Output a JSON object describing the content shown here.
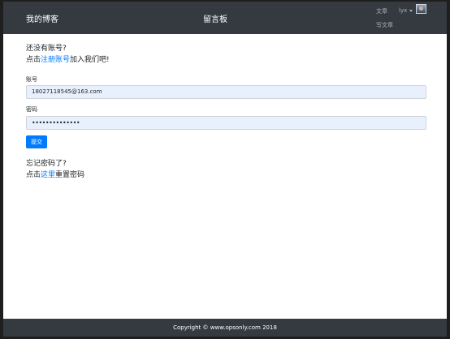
{
  "navbar": {
    "brand": "我的博客",
    "center_title": "留言板",
    "articles_link": "文章",
    "write_article_link": "写文章",
    "username": "lyx"
  },
  "register_prompt": {
    "line1": "还没有账号?",
    "prefix": "点击",
    "link": "注册账号",
    "suffix": "加入我们吧!"
  },
  "form": {
    "account_label": "账号",
    "account_value": "18027118545@163.com",
    "password_label": "密码",
    "password_value": "••••••••••••••",
    "submit_label": "提交"
  },
  "forgot_prompt": {
    "line1": "忘记密码了?",
    "prefix": "点击",
    "link": "这里",
    "suffix": "重置密码"
  },
  "footer": {
    "copyright": "Copyright © www.opsonly.com 2018"
  },
  "colors": {
    "navbar_bg": "#343a40",
    "link": "#007bff",
    "button_bg": "#007bff",
    "input_autofill_bg": "#e8f0fe"
  }
}
